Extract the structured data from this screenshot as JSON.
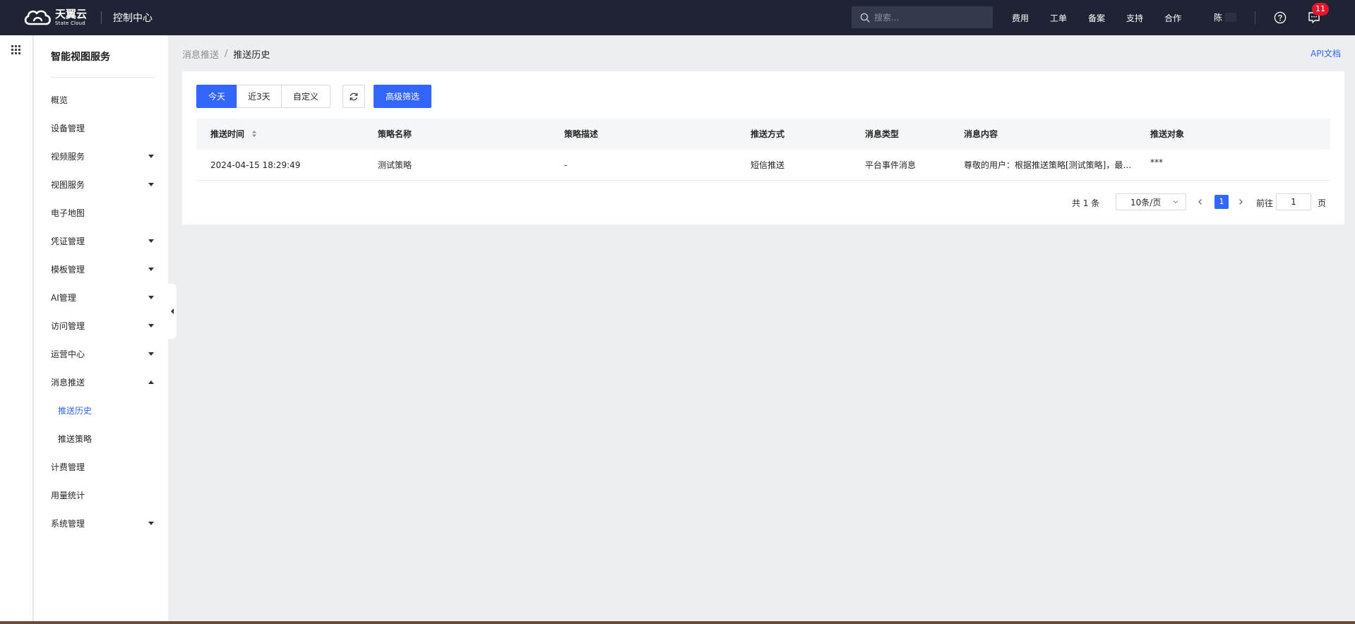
{
  "header": {
    "logo_cn": "天翼云",
    "logo_en": "State Cloud",
    "console_title": "控制中心",
    "search_placeholder": "搜索...",
    "nav": [
      "费用",
      "工单",
      "备案",
      "支持",
      "合作"
    ],
    "user_name": "陈",
    "notification_count": "11"
  },
  "sidebar": {
    "title": "智能视图服务",
    "items": [
      {
        "label": "概览",
        "expandable": false
      },
      {
        "label": "设备管理",
        "expandable": false
      },
      {
        "label": "视频服务",
        "expandable": true
      },
      {
        "label": "视图服务",
        "expandable": true
      },
      {
        "label": "电子地图",
        "expandable": false
      },
      {
        "label": "凭证管理",
        "expandable": true
      },
      {
        "label": "模板管理",
        "expandable": true
      },
      {
        "label": "AI管理",
        "expandable": true
      },
      {
        "label": "访问管理",
        "expandable": true
      },
      {
        "label": "运营中心",
        "expandable": true
      },
      {
        "label": "消息推送",
        "expandable": true,
        "expanded": true
      },
      {
        "label": "推送历史",
        "sub": true,
        "active": true
      },
      {
        "label": "推送策略",
        "sub": true
      },
      {
        "label": "计费管理",
        "expandable": false
      },
      {
        "label": "用量统计",
        "expandable": false
      },
      {
        "label": "系统管理",
        "expandable": true
      }
    ]
  },
  "breadcrumb": {
    "parent": "消息推送",
    "separator": "/",
    "current": "推送历史"
  },
  "api_doc_label": "API文档",
  "toolbar": {
    "ranges": [
      "今天",
      "近3天",
      "自定义"
    ],
    "active_range": "今天",
    "advanced_filter": "高级筛选"
  },
  "table": {
    "columns": [
      "推送时间",
      "策略名称",
      "策略描述",
      "推送方式",
      "消息类型",
      "消息内容",
      "推送对象"
    ],
    "rows": [
      [
        "2024-04-15 18:29:49",
        "测试策略",
        "-",
        "短信推送",
        "平台事件消息",
        "尊敬的用户：根据推送策略[测试策略]，最…",
        "***"
      ]
    ]
  },
  "pagination": {
    "total_text": "共 1 条",
    "page_size": "10条/页",
    "current_page": "1",
    "goto_label": "前往",
    "goto_value": "1",
    "page_unit": "页"
  },
  "colors": {
    "primary": "#3366ff",
    "topbar": "#1f2333",
    "badge": "#e5162b"
  }
}
